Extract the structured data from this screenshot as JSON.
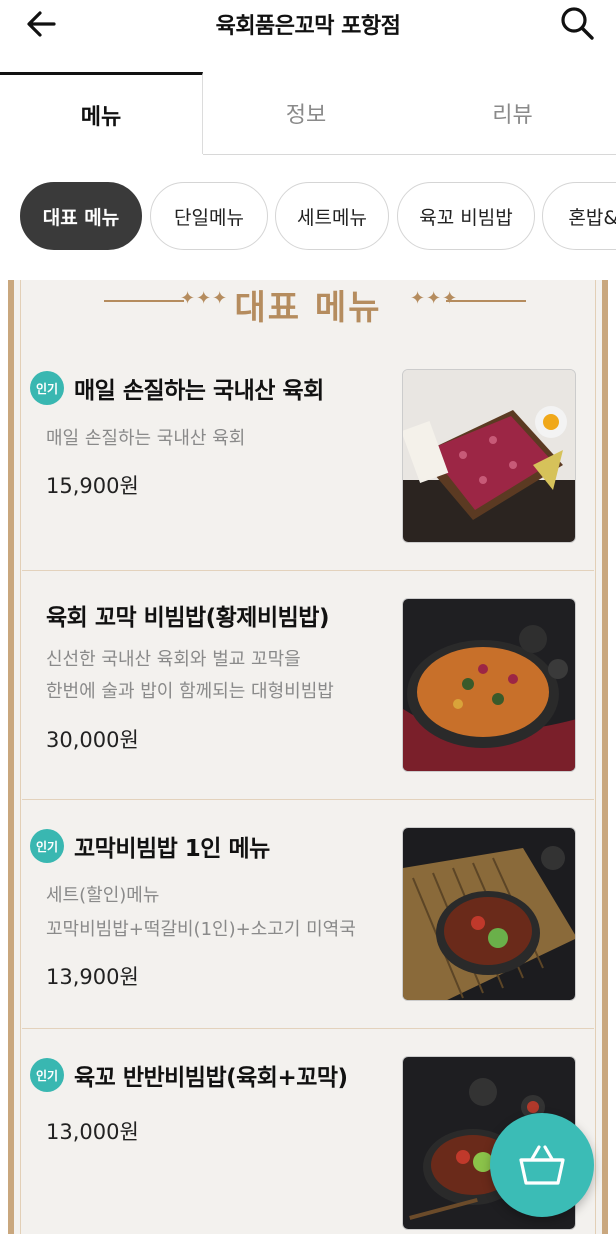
{
  "header": {
    "title": "육회품은꼬막 포항점"
  },
  "tabs": [
    {
      "label": "메뉴",
      "active": true
    },
    {
      "label": "정보",
      "active": false
    },
    {
      "label": "리뷰",
      "active": false
    }
  ],
  "categories": [
    {
      "label": "대표 메뉴",
      "active": true
    },
    {
      "label": "단일메뉴",
      "active": false
    },
    {
      "label": "세트메뉴",
      "active": false
    },
    {
      "label": "육꼬 비빔밥",
      "active": false
    },
    {
      "label": "혼밥&혼",
      "active": false
    }
  ],
  "section": {
    "title": "대표 메뉴",
    "decoration_dots": "✦✦✦"
  },
  "menu_items": [
    {
      "badge": "인기",
      "name": "매일 손질하는 국내산 육회",
      "desc_lines": [
        "매일 손질하는 국내산  육회"
      ],
      "price": "15,900원",
      "image_icon": "raw-beef-platter-image"
    },
    {
      "badge": "",
      "name": "육회 꼬막 비빔밥(황제비빔밥)",
      "desc_lines": [
        "신선한 국내산 육회와 벌교 꼬막을",
        "한번에 술과 밥이 함께되는 대형비빔밥"
      ],
      "price": "30,000원",
      "image_icon": "large-bibimbap-pan-image"
    },
    {
      "badge": "인기",
      "name": "꼬막비빔밥 1인 메뉴",
      "desc_lines": [
        "세트(할인)메뉴",
        "꼬막비빔밥+떡갈비(1인)+소고기 미역국"
      ],
      "price": "13,900원",
      "image_icon": "cockle-bibimbap-bowl-image"
    },
    {
      "badge": "인기",
      "name": "육꼬 반반비빔밥(육회+꼬막)",
      "desc_lines": [],
      "price": "13,000원",
      "image_icon": "half-half-bibimbap-image"
    }
  ],
  "colors": {
    "accent": "#39b7b1",
    "gold": "#b58c5e",
    "board_bg": "#f3f1ee"
  }
}
